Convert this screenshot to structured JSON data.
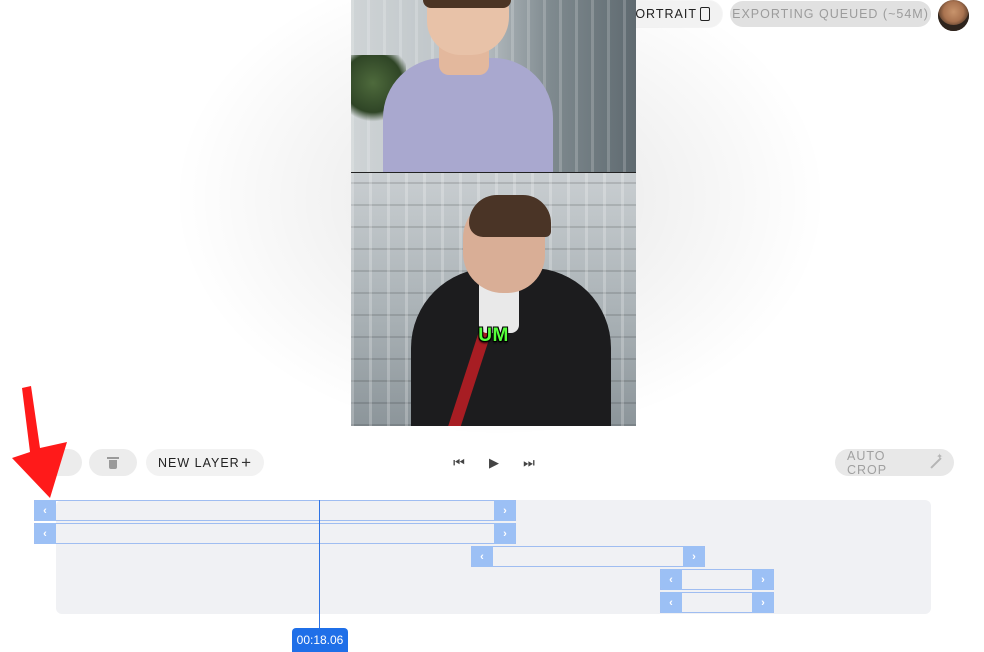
{
  "header": {
    "portrait_label": "PORTRAIT",
    "portrait_icon": "phone-portrait-icon",
    "export_label": "EXPORTING QUEUED (~54M)"
  },
  "preview": {
    "caption": "UM"
  },
  "toolbar": {
    "new_layer_label": "NEW LAYER",
    "new_layer_icon": "+",
    "skip_back_icon": "⏮",
    "play_icon": "▶",
    "skip_forward_icon": "⏭",
    "auto_crop_label": "AUTO CROP",
    "auto_crop_icon": "magic-wand-icon"
  },
  "timeline": {
    "handle_left": "‹",
    "handle_right": "›",
    "playhead_time": "00:18.06"
  },
  "colors": {
    "accent": "#1f6fe8",
    "clip_handle": "#9cc0f5",
    "caption": "#55ff3b",
    "annotation_arrow": "#ff1a1a"
  }
}
